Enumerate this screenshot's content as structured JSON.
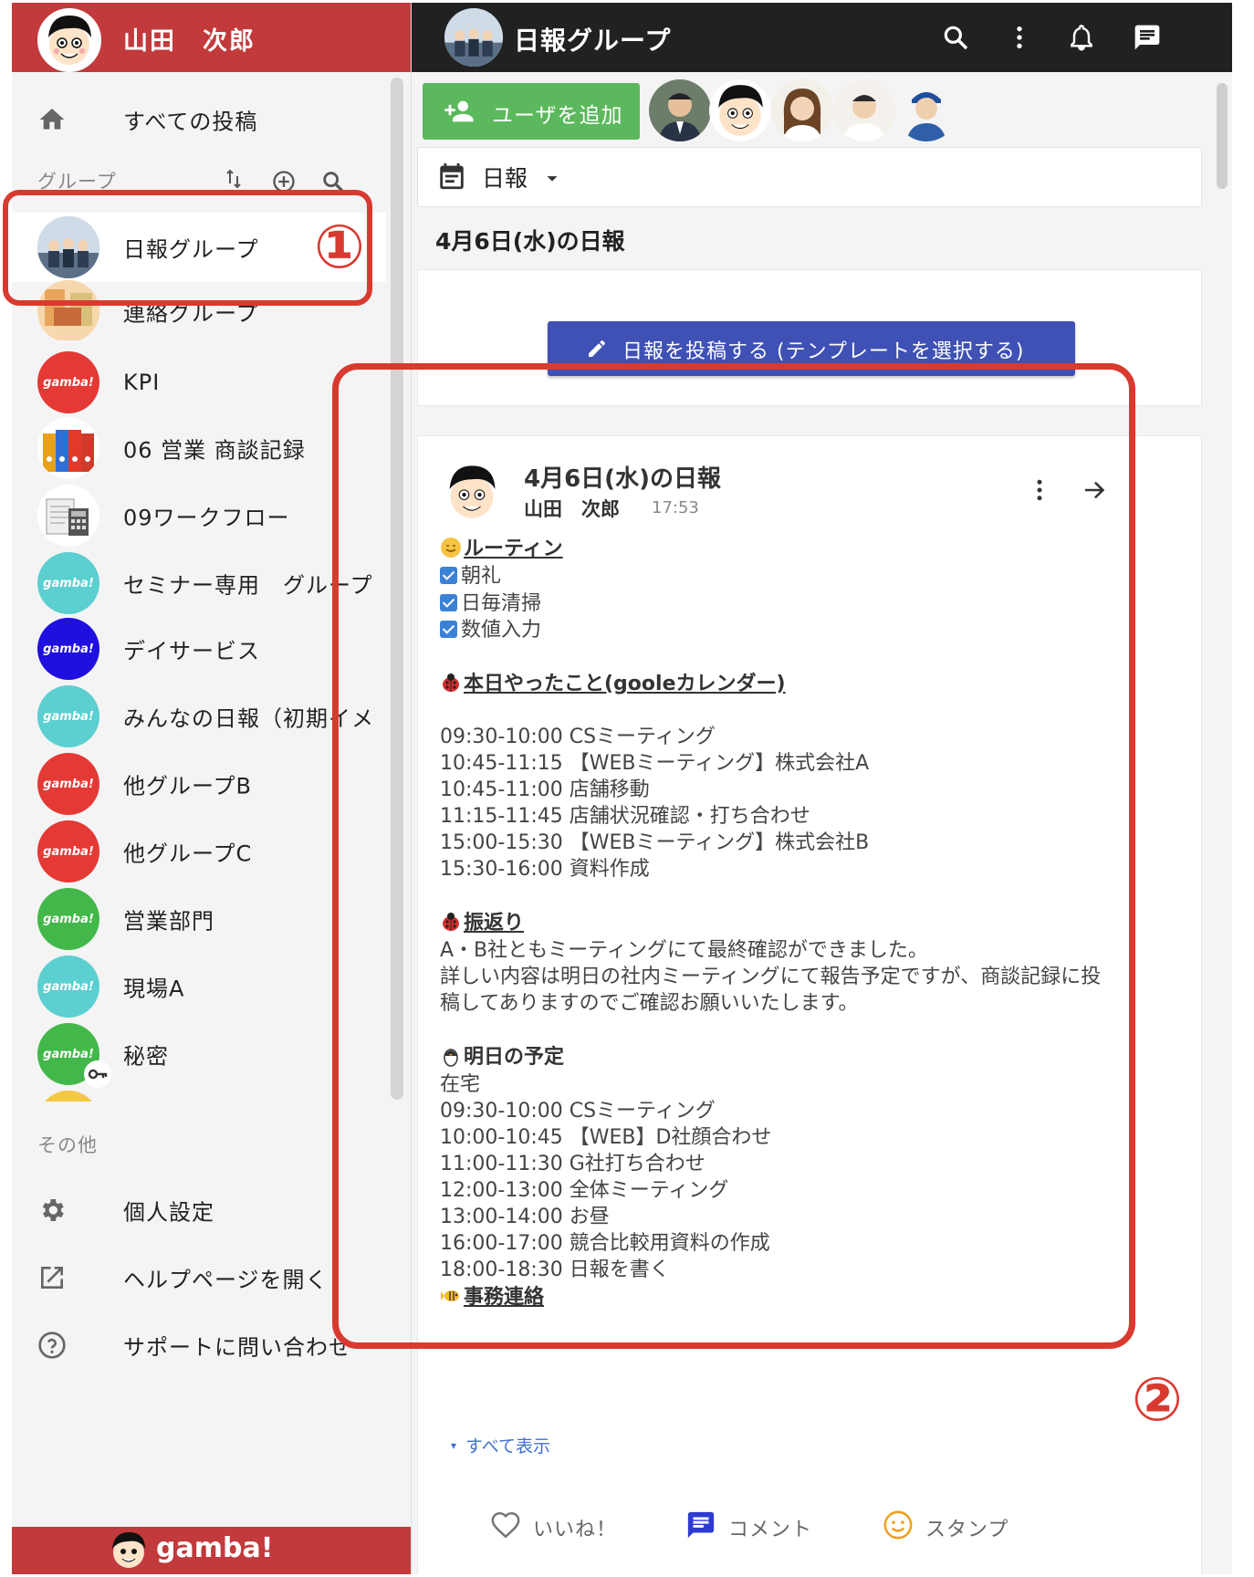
{
  "user": {
    "name": "山田　次郎"
  },
  "sidebar": {
    "all_posts": "すべての投稿",
    "groups_label": "グループ",
    "groups": [
      {
        "label": "日報グループ",
        "active": true
      },
      {
        "label": "連絡グループ"
      },
      {
        "label": "KPI",
        "badge": "gamba!",
        "color": "#e53935"
      },
      {
        "label": "06 営業 商談記録"
      },
      {
        "label": "09ワークフロー"
      },
      {
        "label": "セミナー専用　グループ",
        "badge": "gamba!",
        "color": "#5ccfd0"
      },
      {
        "label": "デイサービス",
        "badge": "gamba!",
        "color": "#1f0fe0"
      },
      {
        "label": "みんなの日報（初期イメ",
        "badge": "gamba!",
        "color": "#5ccfd0"
      },
      {
        "label": "他グループB",
        "badge": "gamba!",
        "color": "#e53935"
      },
      {
        "label": "他グループC",
        "badge": "gamba!",
        "color": "#e53935"
      },
      {
        "label": "営業部門",
        "badge": "gamba!",
        "color": "#43b84a"
      },
      {
        "label": "現場A",
        "badge": "gamba!",
        "color": "#5ccfd0"
      },
      {
        "label": "秘密",
        "badge": "gamba!",
        "color": "#43b84a"
      }
    ],
    "other_label": "その他",
    "settings": "個人設定",
    "help": "ヘルプページを開く",
    "support": "サポートに問い合わせ",
    "footer_brand": "gamba!"
  },
  "topbar": {
    "group_name": "日報グループ"
  },
  "add_user": "ユーザを追加",
  "filter": {
    "label": "日報"
  },
  "date_heading": "4月6日(水)の日報",
  "post_button": "日報を投稿する (テンプレートを選択する)",
  "post": {
    "title": "4月6日(水)の日報",
    "author": "山田　次郎",
    "time": "17:53",
    "routine_heading": "ルーティン",
    "routine_items": [
      "朝礼",
      "日毎清掃",
      "数値入力"
    ],
    "done_heading": "本日やったこと(gooleカレンダー)",
    "done_items": [
      "09:30-10:00  CSミーティング",
      "10:45-11:15  【WEBミーティング】株式会社A",
      "10:45-11:00 店舗移動",
      "11:15-11:45 店舗状況確認・打ち合わせ",
      "15:00-15:30  【WEBミーティング】株式会社B",
      "15:30-16:00 資料作成"
    ],
    "review_heading": "振返り",
    "review_lines": [
      "A・B社ともミーティングにて最終確認ができました。",
      "詳しい内容は明日の社内ミーティングにて報告予定ですが、商談記録に投",
      "稿してありますのでご確認お願いいたします。"
    ],
    "tomorrow_heading": "明日の予定",
    "tomorrow_items": [
      "在宅",
      "09:30-10:00  CSミーティング",
      "10:00-10:45  【WEB】D社顔合わせ",
      "11:00-11:30  G社打ち合わせ",
      "12:00-13:00  全体ミーティング",
      "13:00-14:00  お昼",
      "16:00-17:00  競合比較用資料の作成",
      "18:00-18:30  日報を書く"
    ],
    "office_heading": "事務連絡",
    "show_all": "すべて表示",
    "like": "いいね！",
    "comment": "コメント",
    "stamp": "スタンプ"
  },
  "annotations": {
    "one": "①",
    "two": "②"
  },
  "colors": {
    "brand_red": "#c23a3c",
    "primary": "#3f51b5",
    "green": "#5cb85c",
    "highlight": "#d93a30"
  }
}
